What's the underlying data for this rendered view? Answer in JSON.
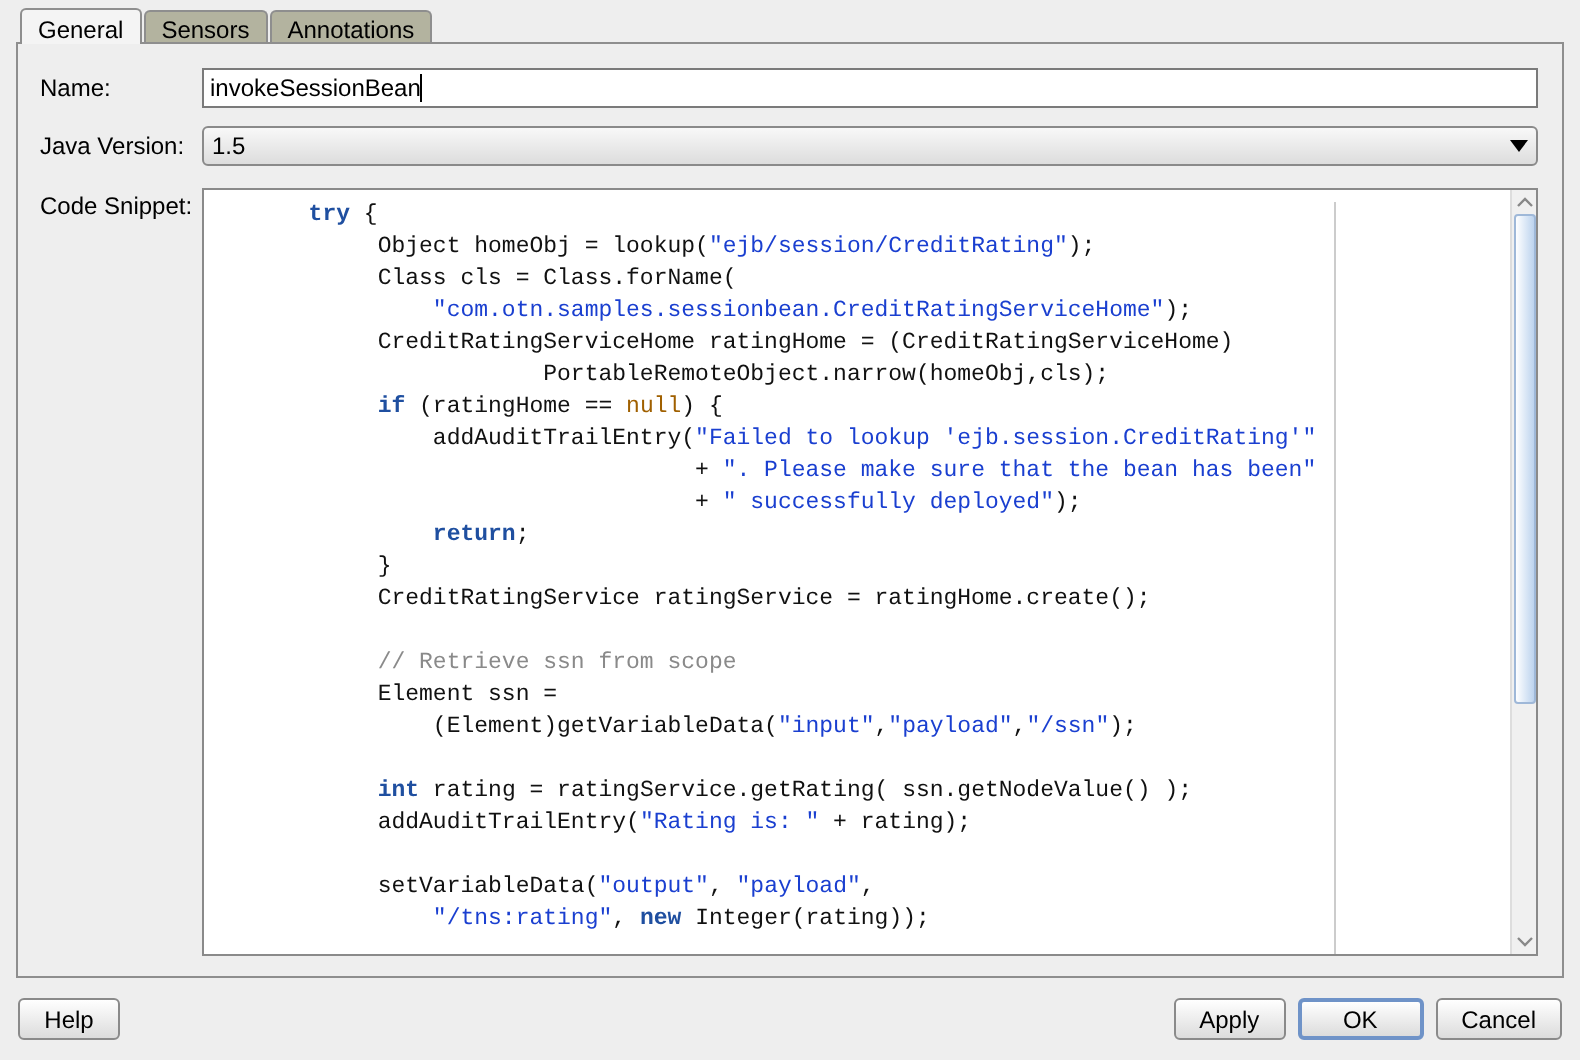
{
  "tabs": [
    {
      "label": "General",
      "selected": true
    },
    {
      "label": "Sensors",
      "selected": false
    },
    {
      "label": "Annotations",
      "selected": false
    }
  ],
  "fields": [
    {
      "kind": "text",
      "label": "Name:",
      "value": "invokeSessionBean"
    },
    {
      "kind": "select",
      "label": "Java Version:",
      "value": "1.5"
    }
  ],
  "code_snippet": {
    "label": "Code Snippet:",
    "lines": [
      {
        "kind": "code",
        "tokens": [
          {
            "kind": "kw",
            "t": "       try"
          },
          {
            "kind": "plain",
            "t": " {"
          }
        ]
      },
      {
        "kind": "code",
        "tokens": [
          {
            "kind": "plain",
            "t": "            Object homeObj = lookup("
          },
          {
            "kind": "str",
            "t": "\"ejb/session/CreditRating\""
          },
          {
            "kind": "plain",
            "t": ");"
          }
        ]
      },
      {
        "kind": "code",
        "tokens": [
          {
            "kind": "plain",
            "t": "            Class cls = Class.forName("
          }
        ]
      },
      {
        "kind": "code",
        "tokens": [
          {
            "kind": "str",
            "t": "                \"com.otn.samples.sessionbean.CreditRatingServiceHome\""
          },
          {
            "kind": "plain",
            "t": ");"
          }
        ]
      },
      {
        "kind": "code",
        "tokens": [
          {
            "kind": "plain",
            "t": "            CreditRatingServiceHome ratingHome = (CreditRatingServiceHome)"
          }
        ]
      },
      {
        "kind": "code",
        "tokens": [
          {
            "kind": "plain",
            "t": "                        PortableRemoteObject.narrow(homeObj,cls);"
          }
        ]
      },
      {
        "kind": "code",
        "tokens": [
          {
            "kind": "kw",
            "t": "            if"
          },
          {
            "kind": "plain",
            "t": " (ratingHome == "
          },
          {
            "kind": "lit",
            "t": "null"
          },
          {
            "kind": "plain",
            "t": ") {"
          }
        ]
      },
      {
        "kind": "code",
        "tokens": [
          {
            "kind": "plain",
            "t": "                addAuditTrailEntry("
          },
          {
            "kind": "str",
            "t": "\"Failed to lookup 'ejb.session.CreditRating'\""
          }
        ]
      },
      {
        "kind": "code",
        "tokens": [
          {
            "kind": "plain",
            "t": "                                   + "
          },
          {
            "kind": "str",
            "t": "\". Please make sure that the bean has been\""
          }
        ]
      },
      {
        "kind": "code",
        "tokens": [
          {
            "kind": "plain",
            "t": "                                   + "
          },
          {
            "kind": "str",
            "t": "\" successfully deployed\""
          },
          {
            "kind": "plain",
            "t": ");"
          }
        ]
      },
      {
        "kind": "code",
        "tokens": [
          {
            "kind": "kw",
            "t": "                return"
          },
          {
            "kind": "plain",
            "t": ";"
          }
        ]
      },
      {
        "kind": "code",
        "tokens": [
          {
            "kind": "plain",
            "t": "            }"
          }
        ]
      },
      {
        "kind": "code",
        "tokens": [
          {
            "kind": "plain",
            "t": "            CreditRatingService ratingService = ratingHome.create();"
          }
        ]
      },
      {
        "kind": "blank"
      },
      {
        "kind": "code",
        "tokens": [
          {
            "kind": "comment",
            "t": "            // Retrieve ssn from scope"
          }
        ]
      },
      {
        "kind": "code",
        "tokens": [
          {
            "kind": "plain",
            "t": "            Element ssn ="
          }
        ]
      },
      {
        "kind": "code",
        "tokens": [
          {
            "kind": "plain",
            "t": "                (Element)getVariableData("
          },
          {
            "kind": "str",
            "t": "\"input\""
          },
          {
            "kind": "plain",
            "t": ","
          },
          {
            "kind": "str",
            "t": "\"payload\""
          },
          {
            "kind": "plain",
            "t": ","
          },
          {
            "kind": "str",
            "t": "\"/ssn\""
          },
          {
            "kind": "plain",
            "t": ");"
          }
        ]
      },
      {
        "kind": "blank"
      },
      {
        "kind": "code",
        "tokens": [
          {
            "kind": "kw",
            "t": "            int"
          },
          {
            "kind": "plain",
            "t": " rating = ratingService.getRating( ssn.getNodeValue() );"
          }
        ]
      },
      {
        "kind": "code",
        "tokens": [
          {
            "kind": "plain",
            "t": "            addAuditTrailEntry("
          },
          {
            "kind": "str",
            "t": "\"Rating is: \""
          },
          {
            "kind": "plain",
            "t": " + rating);"
          }
        ]
      },
      {
        "kind": "blank"
      },
      {
        "kind": "code",
        "tokens": [
          {
            "kind": "plain",
            "t": "            setVariableData("
          },
          {
            "kind": "str",
            "t": "\"output\""
          },
          {
            "kind": "plain",
            "t": ", "
          },
          {
            "kind": "str",
            "t": "\"payload\""
          },
          {
            "kind": "plain",
            "t": ","
          }
        ]
      },
      {
        "kind": "code",
        "tokens": [
          {
            "kind": "str",
            "t": "                \"/tns:rating\""
          },
          {
            "kind": "plain",
            "t": ", "
          },
          {
            "kind": "kw",
            "t": "new"
          },
          {
            "kind": "plain",
            "t": " Integer(rating));"
          }
        ]
      }
    ]
  },
  "buttons_left": [
    {
      "label": "Help",
      "default": false
    }
  ],
  "buttons_right": [
    {
      "label": "Apply",
      "default": false
    },
    {
      "label": "OK",
      "default": true
    },
    {
      "label": "Cancel",
      "default": false
    }
  ]
}
